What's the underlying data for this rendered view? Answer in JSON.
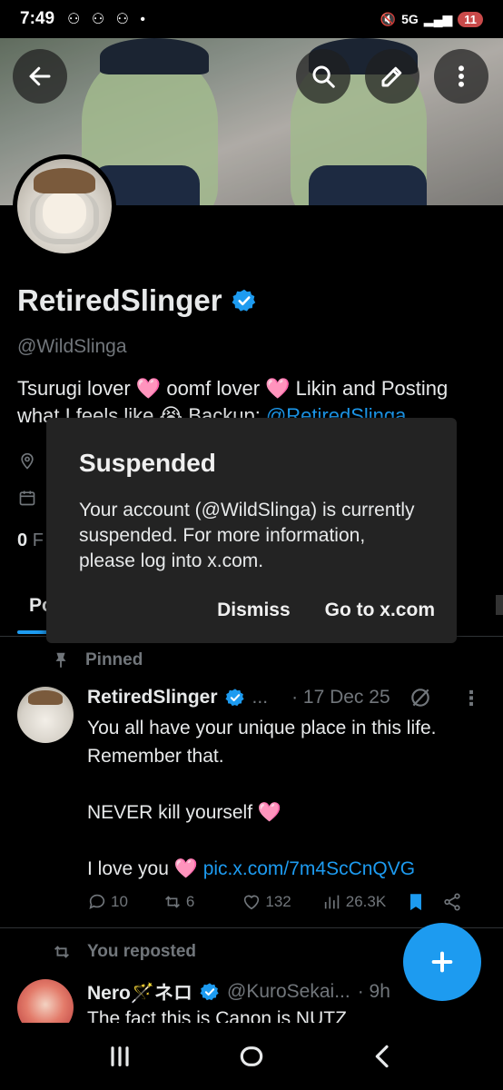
{
  "status_bar": {
    "time": "7:49",
    "notif_icons": "⚇ ⚇ ⚇ •",
    "network": "5G",
    "battery": "11"
  },
  "profile": {
    "name": "RetiredSlinger",
    "handle": "@WildSlinga",
    "bio_prefix": "Tsurugi lover 🩷 oomf lover 🩷  Likin and Posting what I feels like 😭 Backup: ",
    "bio_link": "@RetiredSlinga",
    "following_frag": "0",
    "following_frag_rest": "F",
    "tab_frag": "Po"
  },
  "dialog": {
    "title": "Suspended",
    "body": "Your account (@WildSlinga) is currently suspended. For more information, please log into x.com.",
    "dismiss": "Dismiss",
    "goto": "Go to x.com"
  },
  "pinned_label": "Pinned",
  "tweet1": {
    "name": "RetiredSlinger",
    "ellipsis": "...",
    "date": "· 17 Dec 25",
    "line1": "You all have your unique place in this life.",
    "line2": "Remember that.",
    "line3": "NEVER kill yourself 🩷",
    "line4_prefix": "I love you 🩷 ",
    "line4_link": "pic.x.com/7m4ScCnQVG",
    "replies": "10",
    "reposts": "6",
    "likes": "132",
    "views": "26.3K"
  },
  "repost_label": "You reposted",
  "tweet2": {
    "name": "Nero🪄ネロ",
    "handle": "@KuroSekai...",
    "time": "· 9h",
    "text": "The fact this is Canon is NUTZ"
  },
  "colors": {
    "accent": "#1d9bf0",
    "background": "#000000",
    "dialog": "#232323",
    "muted": "#71767b"
  }
}
